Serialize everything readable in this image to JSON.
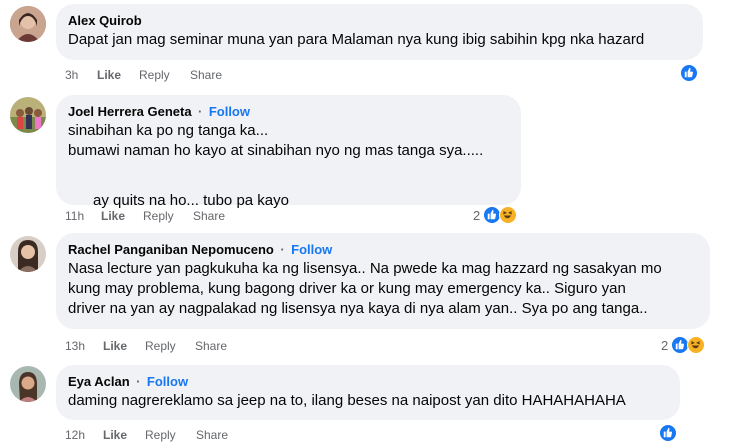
{
  "comments": [
    {
      "author": "Alex Quirob",
      "follow": "",
      "lines": [
        "Dapat jan mag seminar muna yan para Malaman nya kung ibig sabihin kpg nka hazard"
      ],
      "time": "3h",
      "like_label": "Like",
      "reply_label": "Reply",
      "share_label": "Share",
      "reaction_count": ""
    },
    {
      "author": "Joel Herrera Geneta",
      "follow": "Follow",
      "lines": [
        "sinabihan ka po ng tanga ka...",
        "bumawi naman ho kayo at sinabihan nyo ng mas tanga sya.....",
        "ay quits na ho... tubo pa kayo"
      ],
      "time": "11h",
      "like_label": "Like",
      "reply_label": "Reply",
      "share_label": "Share",
      "reaction_count": "2"
    },
    {
      "author": "Rachel Panganiban Nepomuceno",
      "follow": "Follow",
      "lines": [
        "Nasa lecture yan pagkukuha ka ng lisensya.. Na pwede ka mag hazzard ng sasakyan mo",
        "kung may problema, kung bagong driver ka or kung may emergency ka.. Siguro yan",
        "driver na yan ay nagpalakad ng lisensya nya kaya di nya alam yan.. Sya po ang tanga.."
      ],
      "time": "13h",
      "like_label": "Like",
      "reply_label": "Reply",
      "share_label": "Share",
      "reaction_count": "2"
    },
    {
      "author": "Eya Aclan",
      "follow": "Follow",
      "lines": [
        "daming nagrereklamo sa jeep na to, ilang beses na naipost yan dito HAHAHAHAHA"
      ],
      "time": "12h",
      "like_label": "Like",
      "reply_label": "Reply",
      "share_label": "Share",
      "reaction_count": ""
    }
  ],
  "separator": "·",
  "icons": {
    "like": "thumbs-up-reaction-icon",
    "haha": "haha-reaction-icon",
    "thumbs_emoji": "thumbs-up-emoji-icon",
    "grin_emoji": "grinning-emoji-icon",
    "victory_emoji": "victory-hand-emoji-icon"
  },
  "colors": {
    "bubble": "#f0f2f5",
    "follow": "#1877f2",
    "meta": "#65676b",
    "like": "#1877f2",
    "haha": "#f7b125"
  }
}
